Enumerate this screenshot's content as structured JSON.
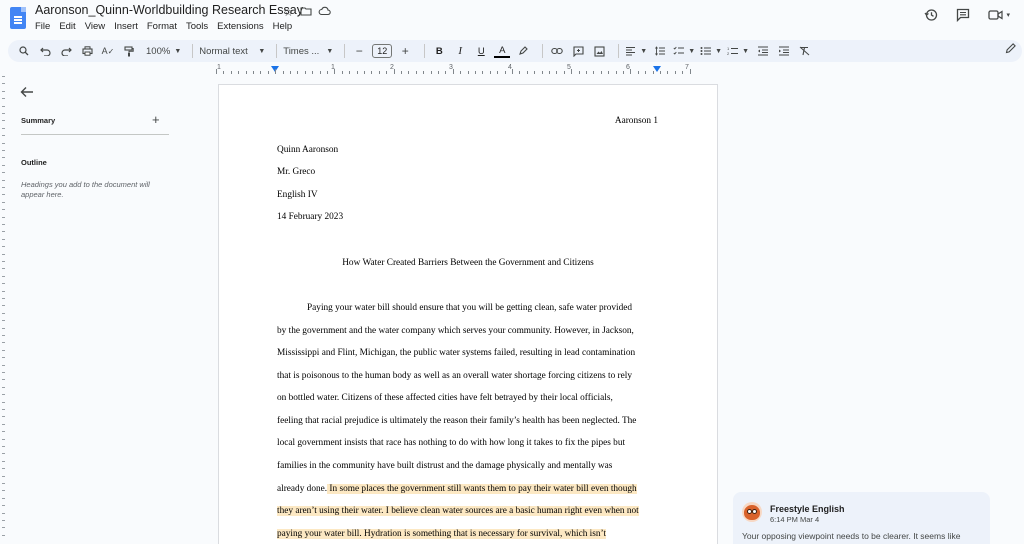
{
  "app": {
    "doc_title": "Aaronson_Quinn-Worldbuilding Research Essay",
    "menu": [
      "File",
      "Edit",
      "View",
      "Insert",
      "Format",
      "Tools",
      "Extensions",
      "Help"
    ]
  },
  "toolbar": {
    "zoom": "100%",
    "style": "Normal text",
    "font": "Times ...",
    "font_size": "12",
    "bold": "B",
    "italic": "I",
    "underline": "U",
    "text_color": "A"
  },
  "ruler": {
    "labels": [
      "1",
      "1",
      "2",
      "3",
      "4",
      "5",
      "6",
      "7"
    ]
  },
  "sidebar": {
    "summary_label": "Summary",
    "outline_label": "Outline",
    "outline_hint": "Headings you add to the document will appear here."
  },
  "document": {
    "page_header": "Aaronson 1",
    "heading_lines": [
      "Quinn Aaronson",
      "Mr. Greco",
      "English IV",
      "14 February 2023"
    ],
    "title": "How Water Created Barriers Between the Government and Citizens",
    "paragraph_lines": [
      "Paying your water bill should ensure that you will be getting clean, safe water provided",
      "by the government and the water company which serves your community. However, in Jackson,",
      "Mississippi and Flint, Michigan, the public water systems failed, resulting in lead contamination",
      "that is poisonous to the human body as well as an overall water shortage forcing citizens to rely",
      "on bottled water. Citizens of these affected cities have felt betrayed by their local officials,",
      "feeling that racial prejudice is ultimately the reason their family’s health has been neglected. The",
      "local government insists that race has nothing to do with how long it takes to fix the pipes but",
      "families in the community have built distrust and the damage physically and mentally was",
      "already done.",
      " In some places the government still wants them to pay their water bill even though",
      "they aren’t using their water. I believe clean water sources are a basic human right even when not",
      "paying your water bill. Hydration is something that is necessary for survival, which isn’t"
    ],
    "highlight_color": "#fce8c3"
  },
  "comment": {
    "author": "Freestyle English",
    "time": "6:14 PM Mar 4",
    "text": "Your opposing viewpoint needs to be clearer. It seems like"
  }
}
